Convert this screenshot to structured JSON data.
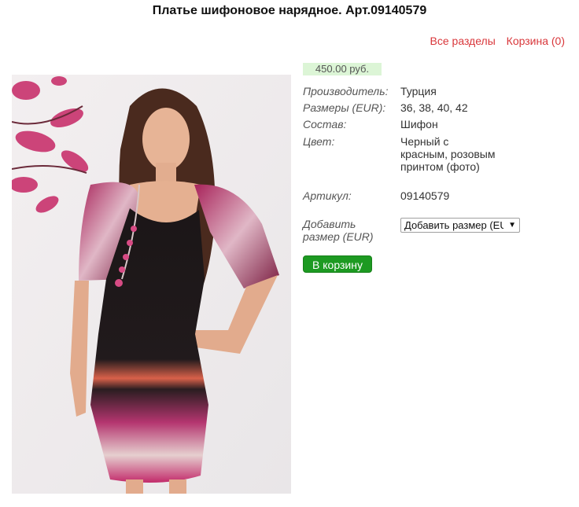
{
  "page": {
    "title": "Платье шифоновое нарядное. Арт.09140579"
  },
  "nav": {
    "all_sections": "Все разделы",
    "cart": "Корзина (0)"
  },
  "product": {
    "price": "450.00 руб.",
    "specs": [
      {
        "label": "Производитель:",
        "value": "Турция"
      },
      {
        "label": "Размеры (EUR):",
        "value": "36, 38, 40, 42"
      },
      {
        "label": "Состав:",
        "value": "Шифон"
      },
      {
        "label": "Цвет:",
        "value": "Черный с красным, розовым принтом (фото)"
      },
      {
        "label": "Артикул:",
        "value": "09140579"
      }
    ],
    "add_size_label": "Добавить размер (EUR)",
    "size_select_value": "Добавить размер (EUR)",
    "cart_button": "В корзину"
  },
  "colors": {
    "link": "#d9373b",
    "price_bg": "#dcf5d6",
    "button_bg": "#1d9a22"
  }
}
